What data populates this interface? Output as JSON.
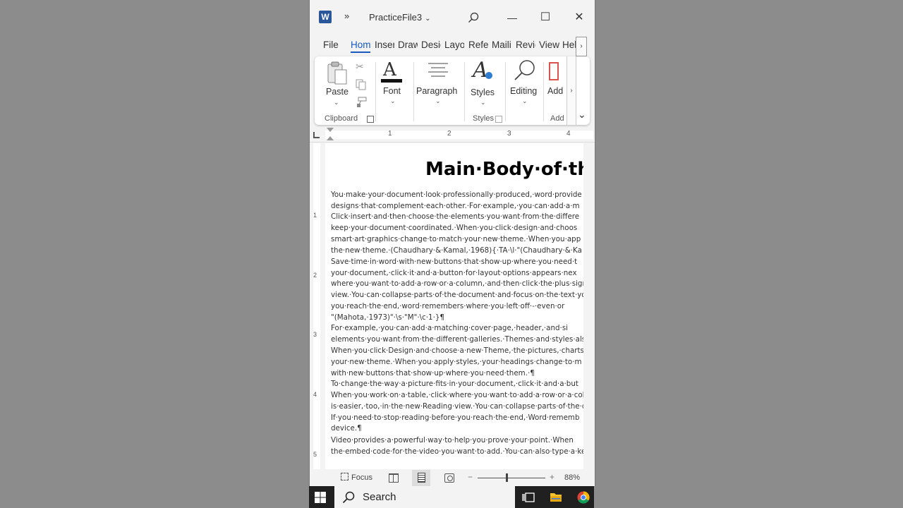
{
  "titlebar": {
    "app_logo": "W",
    "qat_more": "»",
    "doc_title": "PracticeFile3",
    "title_chevron": "⌄",
    "search_icon": "search-icon",
    "minimize": "—",
    "maximize": "☐",
    "close": "✕"
  },
  "tabs": [
    "File",
    "Hom",
    "Inser",
    "Draw",
    "Desig",
    "Layo",
    "Refer",
    "Maili",
    "Revie",
    "View",
    "Help"
  ],
  "tab_scroll": "›",
  "ribbon": {
    "paste_label": "Paste",
    "font_label": "Font",
    "paragraph_label": "Paragraph",
    "styles_label": "Styles",
    "editing_label": "Editing",
    "addins_label": "Add",
    "clipboard_group": "Clipboard",
    "styles_group": "Styles",
    "addins_group": "Add",
    "scroll": "›",
    "expand": "⌄"
  },
  "ruler": {
    "numbers": [
      "1",
      "2",
      "3",
      "4"
    ]
  },
  "vruler": {
    "numbers": [
      "1",
      "2",
      "3",
      "4",
      "5"
    ]
  },
  "document": {
    "heading": "Main·Body·of·the·",
    "lines": [
      "You·make·your·document·look·professionally·produced,·word·provide",
      "designs·that·complement·each·other.·For·example,·you·can·add·a·m",
      "Click·insert·and·then·choose·the·elements·you·want·from·the·differe",
      "keep·your·document·coordinated.·When·you·click·design·and·choos",
      "smart·art·graphics·change·to·match·your·new·theme.·When·you·app",
      "the·new·theme.·(Chaudhary·&·Kamal,·1968){·TA·\\l·\"(Chaudhary·&·Ka",
      "Save·time·in·word·with·new·buttons·that·show·up·where·you·need·t",
      "your·document,·click·it·and·a·button·for·layout·options·appears·nex",
      "where·you·want·to·add·a·row·or·a·column,·and·then·click·the·plus·sign.",
      "view.·You·can·collapse·parts·of·the·document·and·focus·on·the·text·yo",
      "you·reach·the·end,·word·remembers·where·you·left·off·-·even·or",
      "\"(Mahota,·1973)\"·\\s·\"M\"·\\c·1·}¶",
      "For·example,·you·can·add·a·matching·cover·page,·header,·and·si",
      "elements·you·want·from·the·different·galleries.·Themes·and·styles·als",
      "When·you·click·Design·and·choose·a·new·Theme,·the·pictures,·charts",
      "your·new·theme.·When·you·apply·styles,·your·headings·change·to·m",
      "with·new·buttons·that·show·up·where·you·need·them.·¶",
      "To·change·the·way·a·picture·fits·in·your·document,·click·it·and·a·but",
      "When·you·work·on·a·table,·click·where·you·want·to·add·a·row·or·a·colu",
      "is·easier,·too,·in·the·new·Reading·view.·You·can·collapse·parts·of·the·d",
      "If·you·need·to·stop·reading·before·you·reach·the·end,·Word·rememb",
      "device.¶",
      "Video·provides·a·powerful·way·to·help·you·prove·your·point.·When",
      "the·embed·code·for·the·video·you·want·to·add.·You·can·also·type·a·ke"
    ]
  },
  "statusbar": {
    "focus": "Focus",
    "minus": "−",
    "plus": "+",
    "zoom": "88%",
    "zoom_level_fraction": 0.43
  },
  "taskbar": {
    "search": "Search"
  },
  "colors": {
    "accent": "#185abd",
    "word_blue": "#2b579a"
  }
}
